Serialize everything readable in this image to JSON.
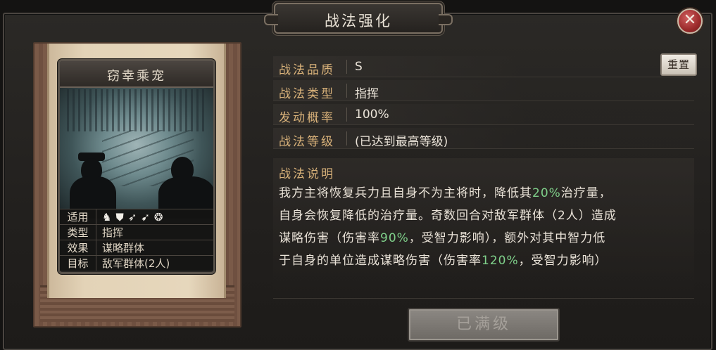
{
  "dialog": {
    "title": "战法强化",
    "close_symbol": "✕"
  },
  "card": {
    "name": "窃幸乘宠",
    "attributes": [
      {
        "key": "适用",
        "icons": [
          "cavalry-icon",
          "shield-icon",
          "bow-icon",
          "spear-icon",
          "wheel-icon"
        ]
      },
      {
        "key": "类型",
        "value": "指挥"
      },
      {
        "key": "效果",
        "value": "谋略群体"
      },
      {
        "key": "目标",
        "value": "敌军群体(2人)"
      }
    ]
  },
  "info": {
    "rows": [
      {
        "key": "战法品质",
        "value": "S"
      },
      {
        "key": "战法类型",
        "value": "指挥"
      },
      {
        "key": "发动概率",
        "value": "100%"
      },
      {
        "key": "战法等级",
        "value": "(已达到最高等级)"
      }
    ],
    "reset_label": "重置",
    "description_title": "战法说明",
    "description": {
      "line1_a": "我方主将恢复兵力且自身不为主将时，降低其",
      "line1_hl": "20%",
      "line1_b": "治疗量，",
      "line2": "自身会恢复降低的治疗量。奇数回合对敌军群体（2人）造成",
      "line3_a": "谋略伤害（伤害率",
      "line3_hl": "90%",
      "line3_b": "，受智力影响），额外对其中智力低",
      "line4_a": "于自身的单位造成谋略伤害（伤害率",
      "line4_hl": "120%",
      "line4_b": "，受智力影响）"
    }
  },
  "footer": {
    "max_level_label": "已满级"
  },
  "colors": {
    "label_gold": "#d9b27a",
    "highlight_green": "#7fd08a",
    "close_red": "#9b2a2a"
  }
}
